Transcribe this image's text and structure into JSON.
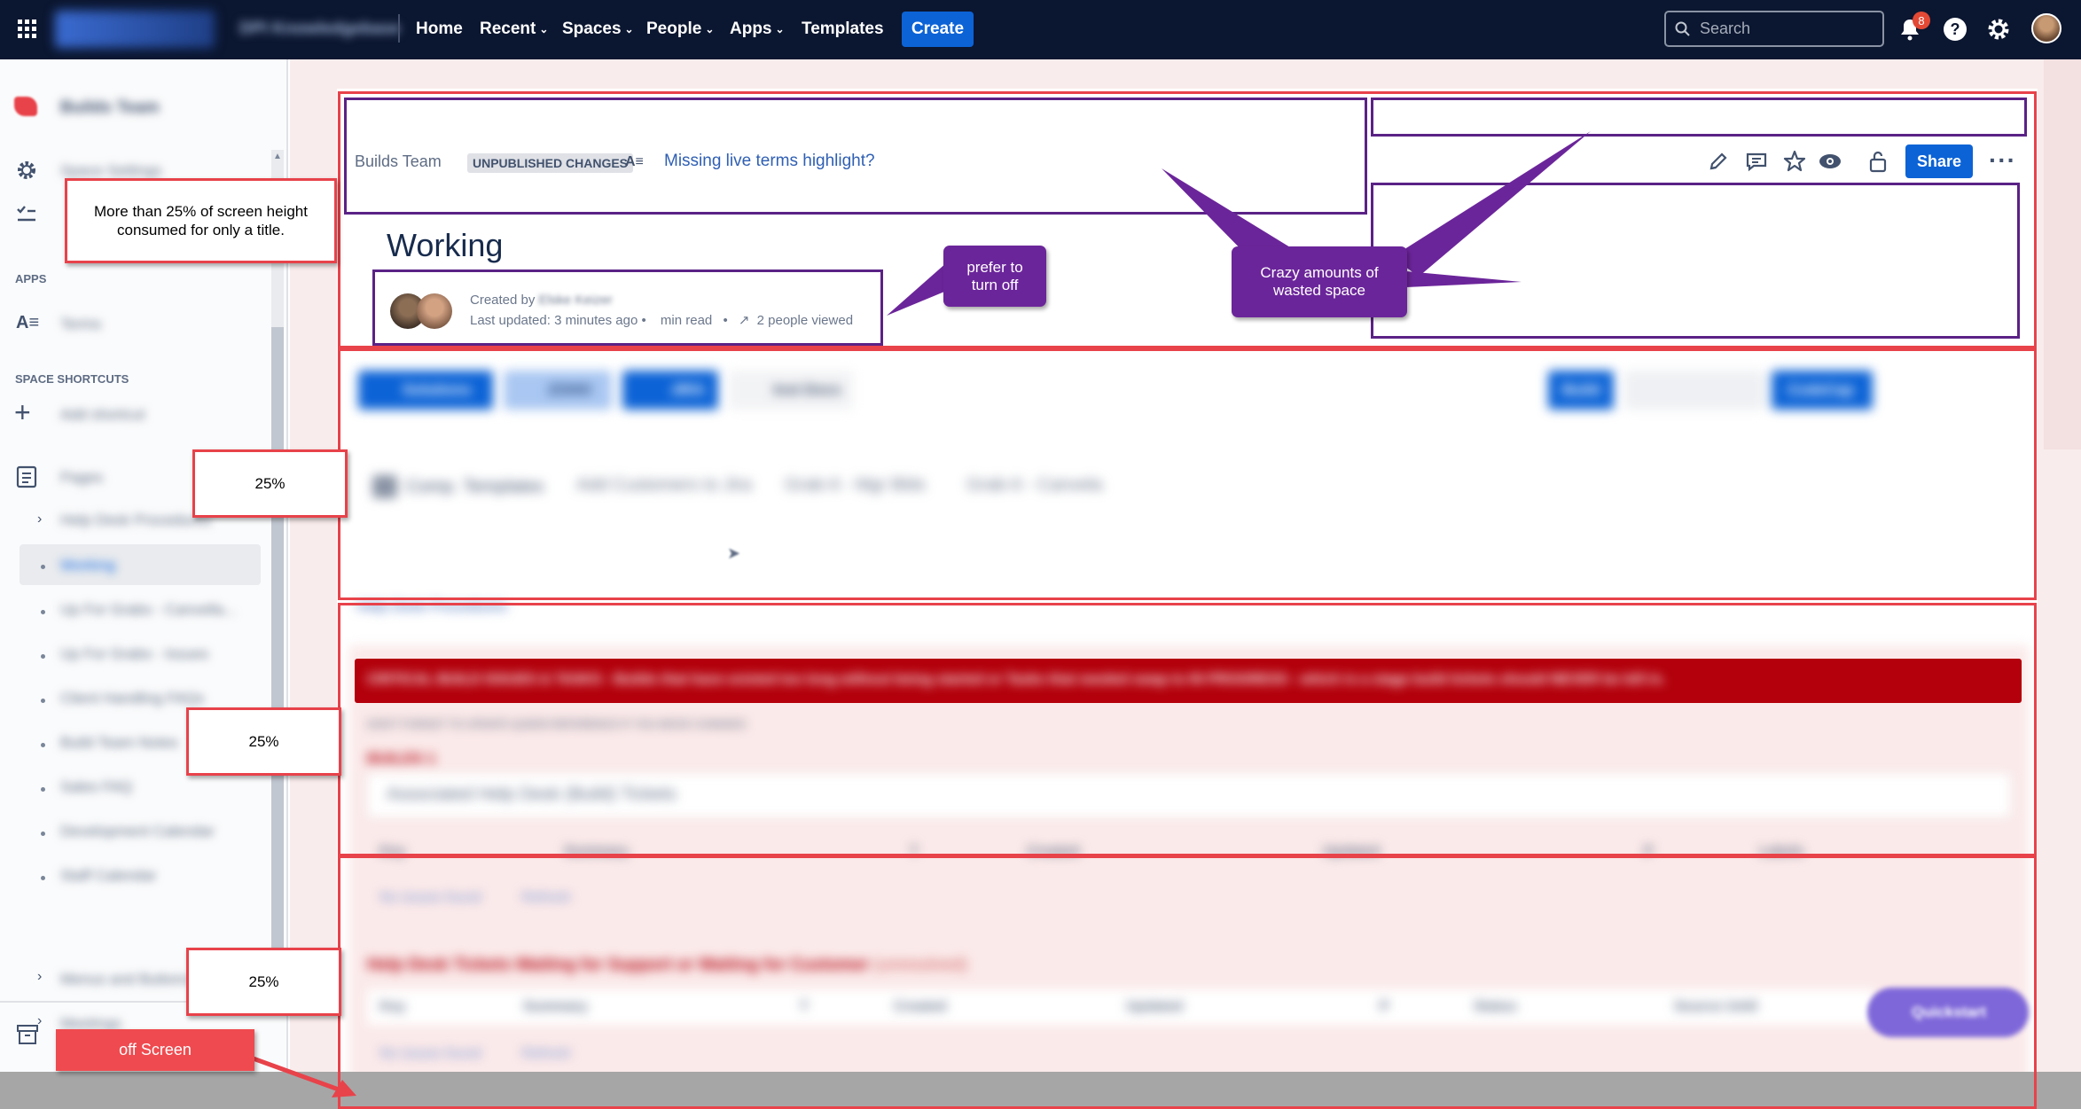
{
  "topbar": {
    "space_name": "DPI Knowledgebase",
    "nav": [
      "Home",
      "Recent",
      "Spaces",
      "People",
      "Apps",
      "Templates"
    ],
    "create_label": "Create",
    "search_placeholder": "Search",
    "notification_count": "8"
  },
  "sidebar": {
    "space_title": "Builds Team",
    "space_settings": "Space Settings",
    "apps_label": "APPS",
    "terms_label": "Terms",
    "shortcuts_label": "SPACE SHORTCUTS",
    "add_shortcut": "Add shortcut",
    "pages_label": "Pages",
    "tree": [
      "Help Desk Procedures",
      "Working",
      "Up For Grabs - Canvella...",
      "Up For Grabs - Issues",
      "Client Handling FAQs",
      "Build Team Notes",
      "Sales FAQ",
      "Development Calendar",
      "Staff Calendar",
      "Menus and Buttons",
      "Meetings"
    ]
  },
  "header": {
    "breadcrumb": "Builds Team",
    "status_lozenge": "UNPUBLISHED CHANGES",
    "missing_terms_link": "Missing live terms highlight?",
    "share_label": "Share"
  },
  "page": {
    "title": "Working",
    "created_by_prefix": "Created by",
    "author": "Elske Keizer",
    "last_updated": "Last updated: 3 minutes ago",
    "read_time": "min read",
    "viewers": "2 people viewed"
  },
  "content": {
    "buttons_left": [
      "Solutions",
      "ZOHO",
      "JIRA",
      "Inst Docs"
    ],
    "buttons_right": [
      "Build",
      "CodeCap"
    ],
    "link_row": [
      "Comp. Templates",
      "Add Customers to Jira",
      "Grab-It - Mgr Blds",
      "Grab-It - Canvela"
    ],
    "help_link": "Help Desk Procedures",
    "alert_banner": "CRITICAL BUILD ISSUES & TASKS - Builds that have existed too long without being started or Tasks that needed swap to IN PROGRESS - which is a stage build tickets should NEVER be left in.",
    "note": "DON'T FORGET TO UPDATE QUEEN REFERENCE IF YOU MOVE CHANGES",
    "builds_heading": "BUILDS",
    "builds_count": "1",
    "table1_title": "Associated Help Desk (Build) Tickets",
    "table1_columns": [
      "Key",
      "Summary",
      "T",
      "Created",
      "Updated",
      "P",
      "Labels"
    ],
    "no_issues": "No issues found",
    "refresh": "Refresh",
    "table2_heading": "Help Desk Tickets Waiting for Support or Waiting for Customer",
    "table2_suffix": "(unresolved)",
    "table2_columns": [
      "Key",
      "Summary",
      "T",
      "Created",
      "Updated",
      "P",
      "Status",
      "Source Until"
    ],
    "quickstart": "Quickstart"
  },
  "annotations": {
    "title_note": "More than 25% of screen height consumed for only a title.",
    "pct_1": "25%",
    "pct_2": "25%",
    "pct_3": "25%",
    "offscreen": "off Screen",
    "prefer_off": "prefer to turn off",
    "wasted_space": "Crazy amounts of wasted space"
  },
  "colors": {
    "topbar": "#0b1630",
    "create_button": "#0c63d6",
    "annotation_red": "#e8424a",
    "annotation_purple": "#6b259a",
    "alert_banner": "#b3000c"
  }
}
